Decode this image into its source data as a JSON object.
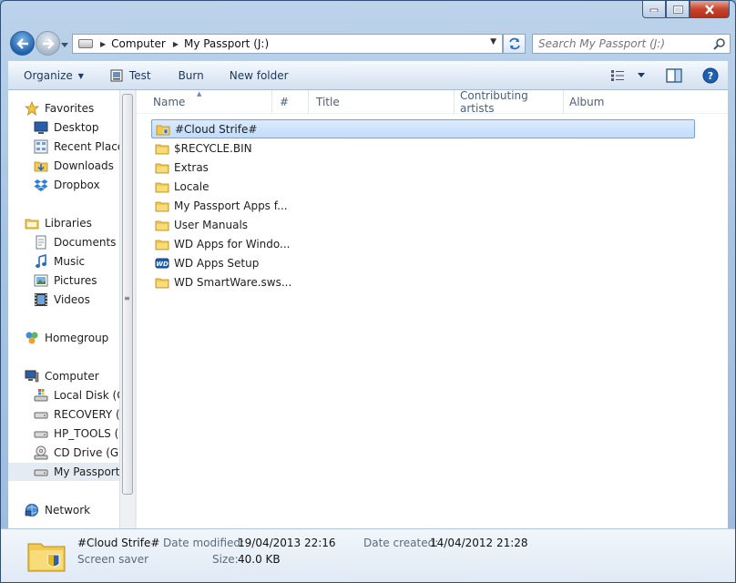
{
  "address": {
    "crumbs": [
      "Computer",
      "My Passport (J:)"
    ]
  },
  "search": {
    "placeholder": "Search My Passport (J:)"
  },
  "toolbar": {
    "organize": "Organize",
    "test": "Test",
    "burn": "Burn",
    "new_folder": "New folder"
  },
  "nav": {
    "favorites": "Favorites",
    "desktop": "Desktop",
    "recent": "Recent Places",
    "downloads": "Downloads",
    "dropbox": "Dropbox",
    "libraries": "Libraries",
    "documents": "Documents",
    "music": "Music",
    "pictures": "Pictures",
    "videos": "Videos",
    "homegroup": "Homegroup",
    "computer": "Computer",
    "local_disk": "Local Disk (C:",
    "recovery": "RECOVERY (D",
    "hp_tools": "HP_TOOLS (E",
    "cd_drive": "CD Drive (G:)",
    "my_passport": "My Passport (",
    "network": "Network"
  },
  "columns": {
    "name": "Name",
    "number": "#",
    "title": "Title",
    "artists": "Contributing artists",
    "album": "Album"
  },
  "files": [
    "#Cloud Strife#",
    "$RECYCLE.BIN",
    "Extras",
    "Locale",
    "My Passport Apps f...",
    "User Manuals",
    "WD Apps for Windo...",
    "WD Apps Setup",
    "WD SmartWare.sws..."
  ],
  "details": {
    "name": "#Cloud Strife#",
    "type": "Screen saver",
    "modified_label": "Date modified:",
    "modified_value": "19/04/2013 22:16",
    "size_label": "Size:",
    "size_value": "40.0 KB",
    "created_label": "Date created:",
    "created_value": "14/04/2012 21:28"
  },
  "icons": {
    "wd_badge": "WD"
  },
  "colors": {
    "selection": "#cce4fc",
    "folder": "#f2c94c",
    "toolbar_text": "#1e395b"
  }
}
